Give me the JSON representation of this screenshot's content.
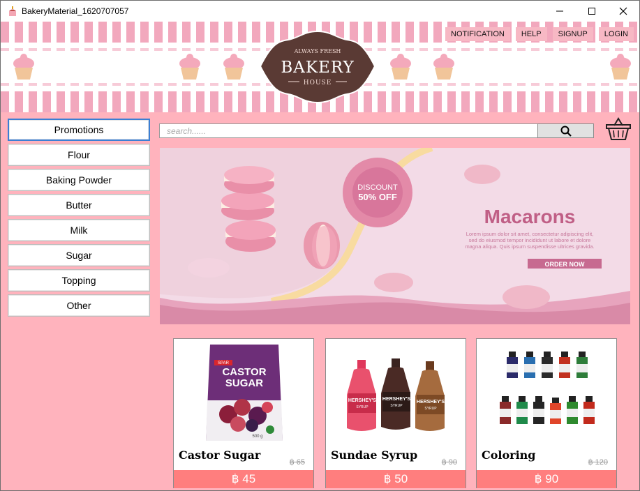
{
  "window": {
    "title": "BakeryMaterial_1620707057"
  },
  "topnav": {
    "items": [
      "NOTIFICATION",
      "HELP",
      "SIGNUP",
      "LOGIN"
    ]
  },
  "logo": {
    "top": "ALWAYS FRESH",
    "main": "BAKERY",
    "bottom": "HOUSE"
  },
  "sidebar": {
    "items": [
      "Promotions",
      "Flour",
      "Baking Powder",
      "Butter",
      "Milk",
      "Sugar",
      "Topping",
      "Other"
    ],
    "active": "Promotions"
  },
  "search": {
    "placeholder": "search......"
  },
  "banner": {
    "discount_line1": "DISCOUNT",
    "discount_line2": "50% OFF",
    "headline": "Macarons",
    "body_lines": [
      "Lorem ipsum dolor sit amet, consectetur adipiscing elit,",
      "sed do eiusmod tempor incididunt ut labore et dolore",
      "magna aliqua. Quis ipsum suspendisse ultrices gravida."
    ],
    "cta": "ORDER NOW"
  },
  "products": [
    {
      "name": "Castor Sugar",
      "old_price": "฿ 65",
      "price": "฿ 45",
      "package_brand": "SPAR",
      "package_line1": "CASTOR",
      "package_line2": "SUGAR",
      "package_weight": "500 g"
    },
    {
      "name": "Sundae Syrup",
      "old_price": "฿ 90",
      "price": "฿ 50",
      "bottle_label": "HERSHEY'S",
      "bottle_sub": "SYRUP"
    },
    {
      "name": "Coloring",
      "old_price": "฿ 120",
      "price": "฿ 90"
    }
  ],
  "colors": {
    "accent": "#ff7e7e",
    "background": "#ffb3bd",
    "logo": "#5a3a34",
    "banner": "#f3dbe7",
    "active_border": "#3b7fd4"
  }
}
